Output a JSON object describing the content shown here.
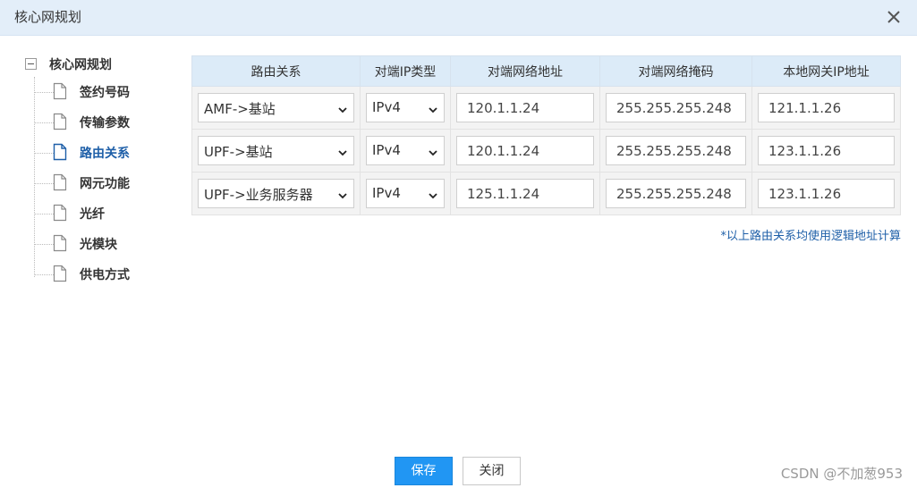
{
  "window": {
    "title": "核心网规划"
  },
  "tree": {
    "root": "核心网规划",
    "items": [
      {
        "label": "签约号码",
        "active": false
      },
      {
        "label": "传输参数",
        "active": false
      },
      {
        "label": "路由关系",
        "active": true
      },
      {
        "label": "网元功能",
        "active": false
      },
      {
        "label": "光纤",
        "active": false
      },
      {
        "label": "光模块",
        "active": false
      },
      {
        "label": "供电方式",
        "active": false
      }
    ]
  },
  "table": {
    "headers": [
      "路由关系",
      "对端IP类型",
      "对端网络地址",
      "对端网络掩码",
      "本地网关IP地址"
    ],
    "rows": [
      {
        "route": "AMF->基站",
        "ip_type": "IPv4",
        "peer_addr": "120.1.1.24",
        "peer_mask": "255.255.255.248",
        "gateway": "121.1.1.26"
      },
      {
        "route": "UPF->基站",
        "ip_type": "IPv4",
        "peer_addr": "120.1.1.24",
        "peer_mask": "255.255.255.248",
        "gateway": "123.1.1.26"
      },
      {
        "route": "UPF->业务服务器",
        "ip_type": "IPv4",
        "peer_addr": "125.1.1.24",
        "peer_mask": "255.255.255.248",
        "gateway": "123.1.1.26"
      }
    ]
  },
  "note": "*以上路由关系均使用逻辑地址计算",
  "buttons": {
    "save": "保存",
    "close": "关闭"
  },
  "watermark": "CSDN @不加葱953",
  "colors": {
    "titlebar": "#e3eef9",
    "header": "#dcebf8",
    "accent": "#2196f3",
    "link": "#1e5fa8"
  }
}
